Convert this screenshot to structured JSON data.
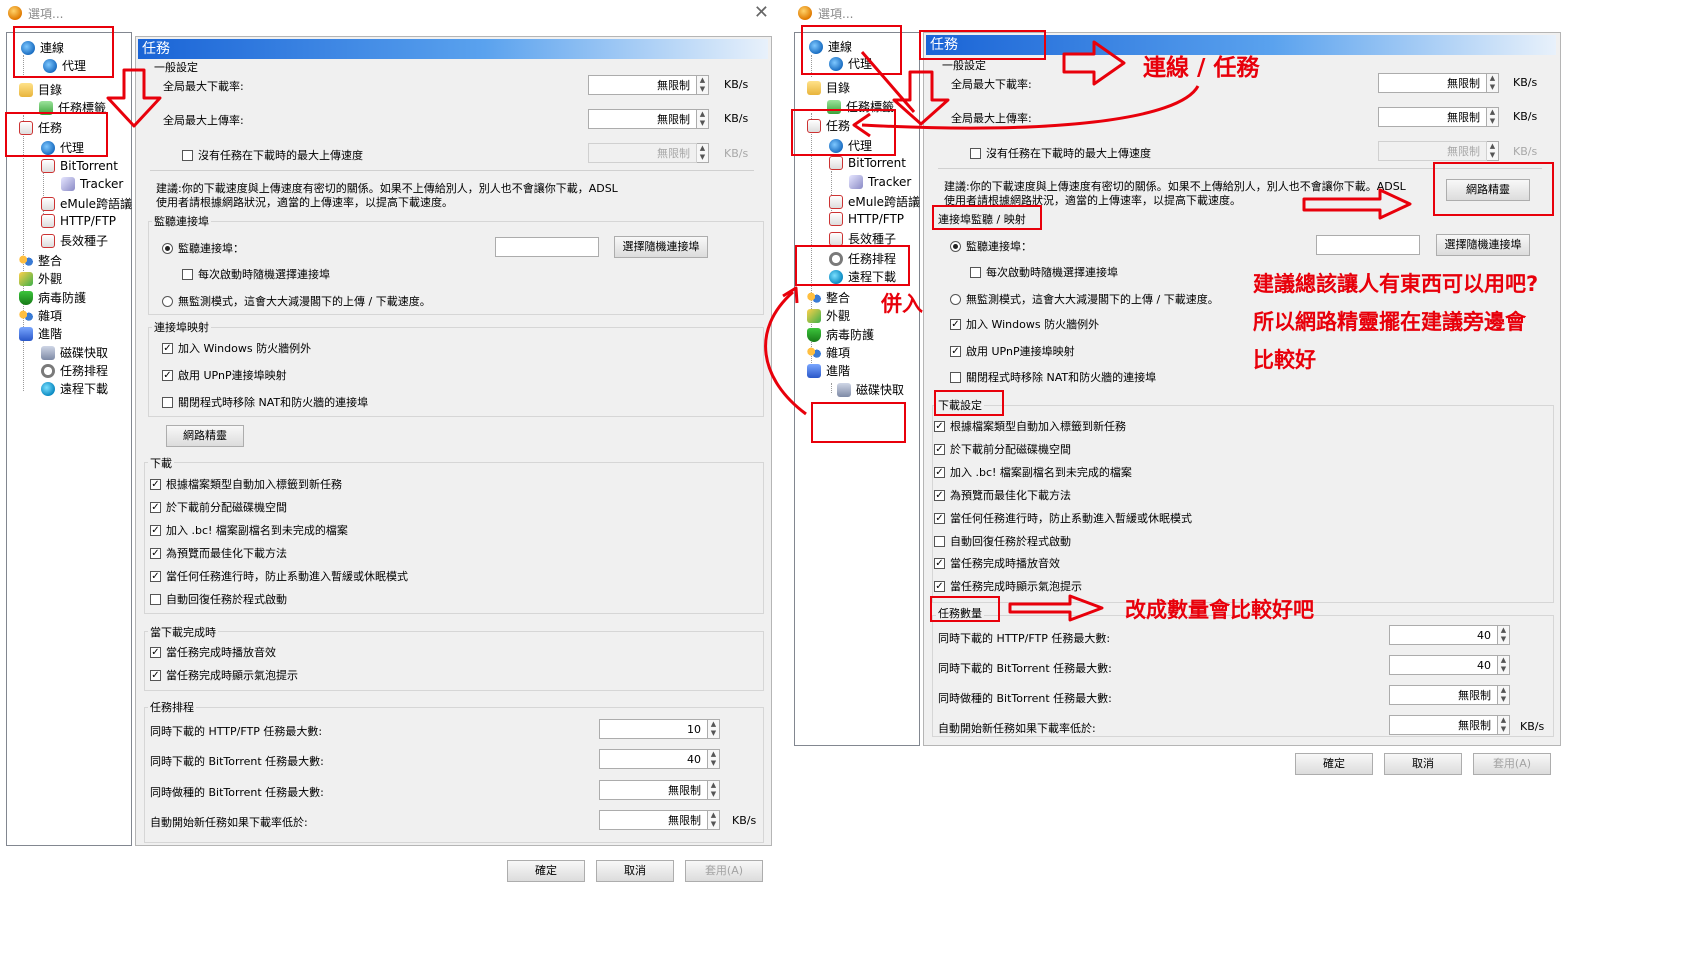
{
  "left_window": {
    "title": "選項...",
    "tree": [
      "連線",
      "代理",
      "目錄",
      "任務標籤",
      "任務",
      "代理",
      "BitTorrent",
      "Tracker",
      "eMule跨語議",
      "HTTP/FTP",
      "長效種子",
      "整合",
      "外觀",
      "病毒防護",
      "雜項",
      "進階",
      "磁碟快取",
      "任務排程",
      "遠程下載"
    ],
    "header": "任務",
    "general_label": "一般設定",
    "max_down_label": "全局最大下載率:",
    "max_down_value": "無限制",
    "max_up_label": "全局最大上傳率:",
    "max_up_value": "無限制",
    "unit_kbs": "KB/s",
    "no_task_label": "沒有任務在下載時的最大上傳速度",
    "no_task_value": "無限制",
    "advice_line1": "建議:你的下載速度與上傳速度有密切的關係。如果不上傳給別人，別人也不會讓你下載，ADSL",
    "advice_line2": "使用者請根據網路狀況，適當的上傳速率，以提高下載速度。",
    "listen_group": "監聽連接埠",
    "listen_port": "監聽連接埠：",
    "random_port_btn": "選擇隨機連接埠",
    "random_each": "每次啟動時隨機選擇連接埠",
    "no_listen": "無監測模式，這會大大減漫閣下的上傳 / 下載速度。",
    "port_map_group": "連接埠映射",
    "firewall": "加入 Windows 防火牆例外",
    "upnp": "啟用 UPnP連接埠映射",
    "close_nat": "關閉程式時移除 NAT和防火牆的連接埠",
    "wizard_btn": "網路精靈",
    "download_group": "下載",
    "dl_items": [
      "根據檔案類型自動加入標籤到新任務",
      "於下載前分配磁碟機空間",
      "加入 .bc! 檔案副檔名到未完成的檔案",
      "為預覽而最佳化下載方法",
      "當任何任務進行時，防止系動進入暫緩或休眠模式",
      "自動回復任務於程式啟動"
    ],
    "complete_group": "當下載完成時",
    "complete_items": [
      "當任務完成時播放音效",
      "當任務完成時顯示氣泡提示"
    ],
    "schedule_group": "任務排程",
    "sched_labels": [
      "同時下載的 HTTP/FTP 任務最大數:",
      "同時下載的 BitTorrent 任務最大數:",
      "同時做種的 BitTorrent 任務最大數:",
      "自動開始新任務如果下載率低於:"
    ],
    "sched_values": [
      "10",
      "40",
      "無限制",
      "無限制"
    ],
    "ok": "確定",
    "cancel": "取消",
    "apply": "套用(A)"
  },
  "right_window": {
    "title": "選項...",
    "tree": [
      "連線",
      "代理",
      "目錄",
      "任務標籤",
      "任務",
      "代理",
      "BitTorrent",
      "Tracker",
      "eMule跨語議",
      "HTTP/FTP",
      "長效種子",
      "任務排程",
      "遠程下載",
      "整合",
      "外觀",
      "病毒防護",
      "雜項",
      "進階",
      "磁碟快取"
    ],
    "header": "任務",
    "general_label": "一般設定",
    "max_down_label": "全局最大下載率:",
    "max_down_value": "無限制",
    "max_up_label": "全局最大上傳率:",
    "max_up_value": "無限制",
    "unit_kbs": "KB/s",
    "no_task_label": "沒有任務在下載時的最大上傳速度",
    "no_task_value": "無限制",
    "advice_line1": "建議:你的下載速度與上傳速度有密切的關係。如果不上傳給別人，別人也不會讓你下載。ADSL",
    "advice_line2": "使用者請根據網路狀況，適當的上傳速率，以提高下載速度。",
    "wizard_btn": "網路精靈",
    "listen_group": "連接埠監聽 / 映射",
    "listen_port": "監聽連接埠：",
    "random_port_btn": "選擇隨機連接埠",
    "random_each": "每次啟動時隨機選擇連接埠",
    "no_listen": "無監測模式，這會大大減漫閣下的上傳 / 下載速度。",
    "firewall": "加入 Windows 防火牆例外",
    "upnp": "啟用 UPnP連接埠映射",
    "close_nat": "關閉程式時移除 NAT和防火牆的連接埠",
    "download_group": "下載設定",
    "dl_items": [
      "根據檔案類型自動加入標籤到新任務",
      "於下載前分配磁碟機空間",
      "加入 .bc! 檔案副檔名到未完成的檔案",
      "為預覽而最佳化下載方法",
      "當任何任務進行時，防止系動進入暫緩或休眠模式",
      "自動回復任務於程式啟動",
      "當任務完成時播放音效",
      "當任務完成時顯示氣泡提示"
    ],
    "dl_checked": [
      true,
      true,
      true,
      true,
      true,
      false,
      true,
      true
    ],
    "count_group": "任務數量",
    "sched_labels": [
      "同時下載的 HTTP/FTP 任務最大數:",
      "同時下載的 BitTorrent 任務最大數:",
      "同時做種的 BitTorrent 任務最大數:",
      "自動開始新任務如果下載率低於:"
    ],
    "sched_values": [
      "40",
      "40",
      "無限制",
      "無限制"
    ],
    "ok": "確定",
    "cancel": "取消",
    "apply": "套用(A)"
  },
  "annotations": {
    "connection_task": "連線 / 任務",
    "merge": "併入",
    "suggest_1": "建議總該讓人有東西可以用吧?",
    "suggest_2": "所以網路精靈擺在建議旁邊會",
    "suggest_3": "比較好",
    "count_note": "改成數量會比較好吧"
  },
  "colors": {
    "annotation_red": "#e8000b",
    "header_blue": "#1a64d6"
  }
}
